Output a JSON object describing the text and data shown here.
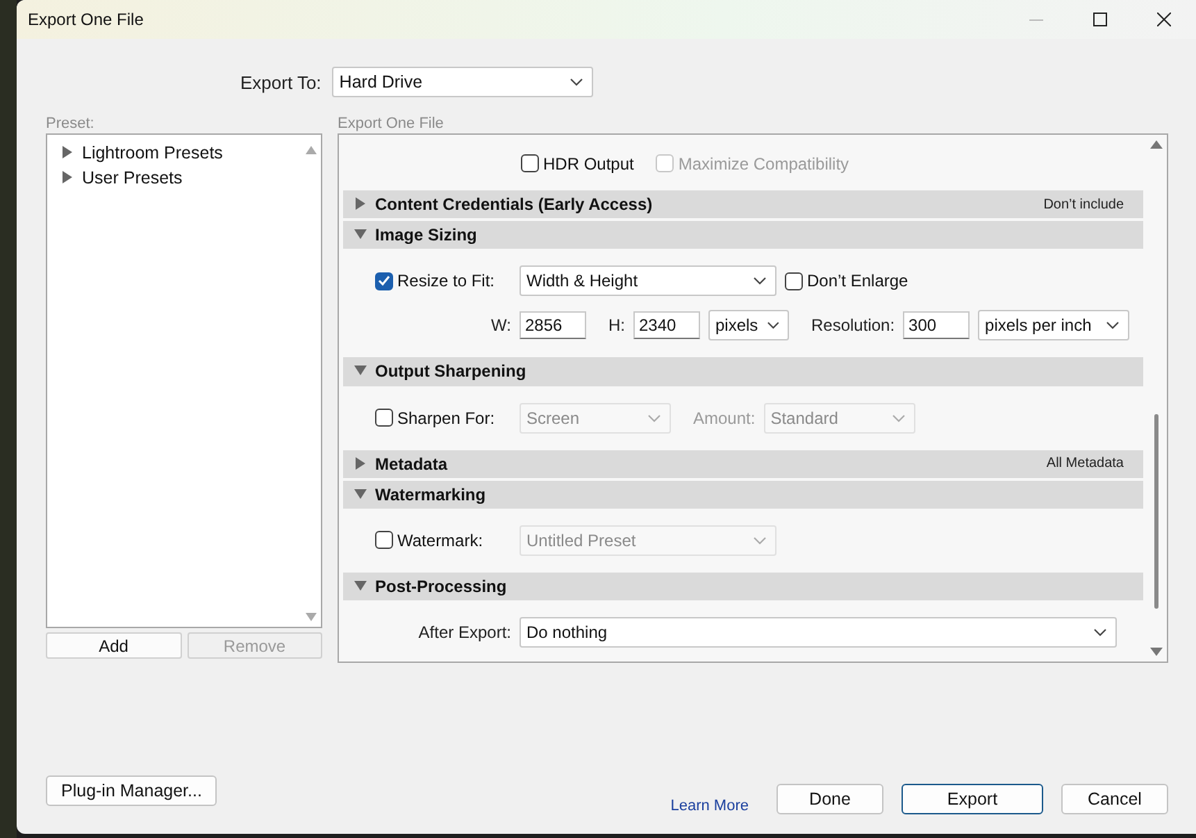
{
  "window": {
    "title": "Export One File"
  },
  "export_to": {
    "label": "Export To:",
    "value": "Hard Drive"
  },
  "preset": {
    "label": "Preset:",
    "items": [
      {
        "label": "Lightroom Presets",
        "expanded": false
      },
      {
        "label": "User Presets",
        "expanded": false
      }
    ],
    "buttons": [
      {
        "label": "Add",
        "disabled": false
      },
      {
        "label": "Remove",
        "disabled": true
      }
    ]
  },
  "panel": {
    "label": "Export One File",
    "leading_options": [
      {
        "label": "HDR Output",
        "checked": false,
        "disabled": false
      },
      {
        "label": "Maximize Compatibility",
        "checked": false,
        "disabled": true
      }
    ],
    "sections": [
      {
        "title": "Content Credentials (Early Access)",
        "expanded": false,
        "summary": "Don’t include"
      },
      {
        "title": "Image Sizing",
        "expanded": true,
        "lines": [
          {
            "controls": [
              {
                "kind": "check",
                "label": "Resize to Fit:",
                "checked": true,
                "disabled": false
              },
              {
                "kind": "select",
                "value": "Width & Height",
                "disabled": false
              },
              {
                "kind": "check",
                "label": "Don’t Enlarge",
                "checked": false,
                "disabled": false
              }
            ]
          },
          {
            "controls": [
              {
                "kind": "label",
                "label": "W:",
                "disabled": false
              },
              {
                "kind": "input",
                "value": "2856"
              },
              {
                "kind": "label",
                "label": "H:",
                "disabled": false
              },
              {
                "kind": "input",
                "value": "2340"
              },
              {
                "kind": "select",
                "value": "pixels",
                "disabled": false
              },
              {
                "kind": "label",
                "label": "Resolution:",
                "disabled": false
              },
              {
                "kind": "input",
                "value": "300"
              },
              {
                "kind": "select",
                "value": "pixels per inch",
                "disabled": false
              }
            ]
          }
        ]
      },
      {
        "title": "Output Sharpening",
        "expanded": true,
        "lines": [
          {
            "controls": [
              {
                "kind": "check",
                "label": "Sharpen For:",
                "checked": false,
                "disabled": false
              },
              {
                "kind": "select",
                "value": "Screen",
                "disabled": true
              },
              {
                "kind": "label",
                "label": "Amount:",
                "disabled": true
              },
              {
                "kind": "select",
                "value": "Standard",
                "disabled": true
              }
            ]
          }
        ]
      },
      {
        "title": "Metadata",
        "expanded": false,
        "summary": "All Metadata"
      },
      {
        "title": "Watermarking",
        "expanded": true,
        "lines": [
          {
            "controls": [
              {
                "kind": "check",
                "label": "Watermark:",
                "checked": false,
                "disabled": false
              },
              {
                "kind": "select",
                "value": "Untitled Preset",
                "disabled": true
              }
            ]
          }
        ]
      },
      {
        "title": "Post-Processing",
        "expanded": true,
        "lines": [
          {
            "controls": [
              {
                "kind": "label",
                "label": "After Export:",
                "disabled": false
              },
              {
                "kind": "select",
                "value": "Do nothing",
                "disabled": false
              }
            ]
          }
        ]
      }
    ]
  },
  "footer": {
    "plugin_button": "Plug-in Manager...",
    "link": "Learn More",
    "buttons": [
      {
        "label": "Done",
        "default": false
      },
      {
        "label": "Export",
        "default": true
      },
      {
        "label": "Cancel",
        "default": false
      }
    ]
  }
}
